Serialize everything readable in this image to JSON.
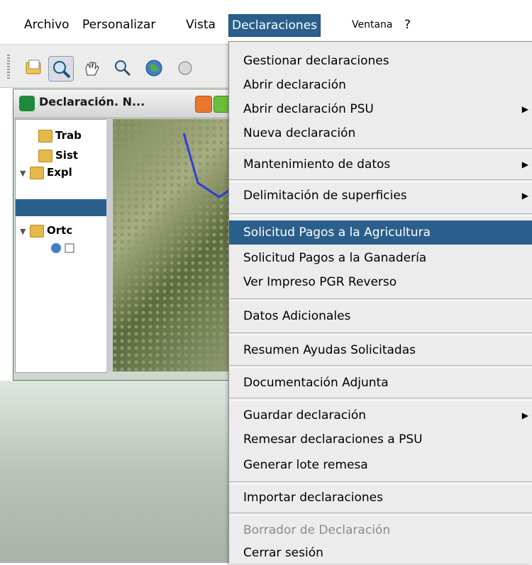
{
  "menubar": {
    "items": [
      "Archivo",
      "Personalizar",
      "Vista",
      "Declaraciones",
      "Ventana",
      "?"
    ]
  },
  "frame": {
    "title": "Declaración. N..."
  },
  "tree": {
    "nodes": [
      "Trab",
      "Sist",
      "Expl",
      "Ortc"
    ]
  },
  "menu": {
    "items": [
      "Gestionar declaraciones",
      "Abrir declaración",
      "Abrir declaración PSU",
      "Nueva declaración",
      "Mantenimiento de datos",
      "Delimitación de superficies",
      "Solicitud Pagos a la Agricultura",
      "Solicitud Pagos a la Ganadería",
      "Ver Impreso PGR Reverso",
      "Datos Adicionales",
      "Resumen Ayudas Solicitadas",
      "Documentación Adjunta",
      "Guardar declaración",
      "Remesar declaraciones a PSU",
      "Generar lote remesa",
      "Importar declaraciones",
      "Borrador de Declaración",
      "Cerrar sesión"
    ],
    "submenu_arrow": "▶"
  },
  "icons": {
    "toolbar": [
      "open-file-icon",
      "zoom-icon",
      "pan-hand-icon",
      "zoom-area-icon",
      "globe-icon"
    ]
  },
  "colors": {
    "highlight": "#2a5f8c",
    "disabled_text": "#8a8a8a"
  }
}
